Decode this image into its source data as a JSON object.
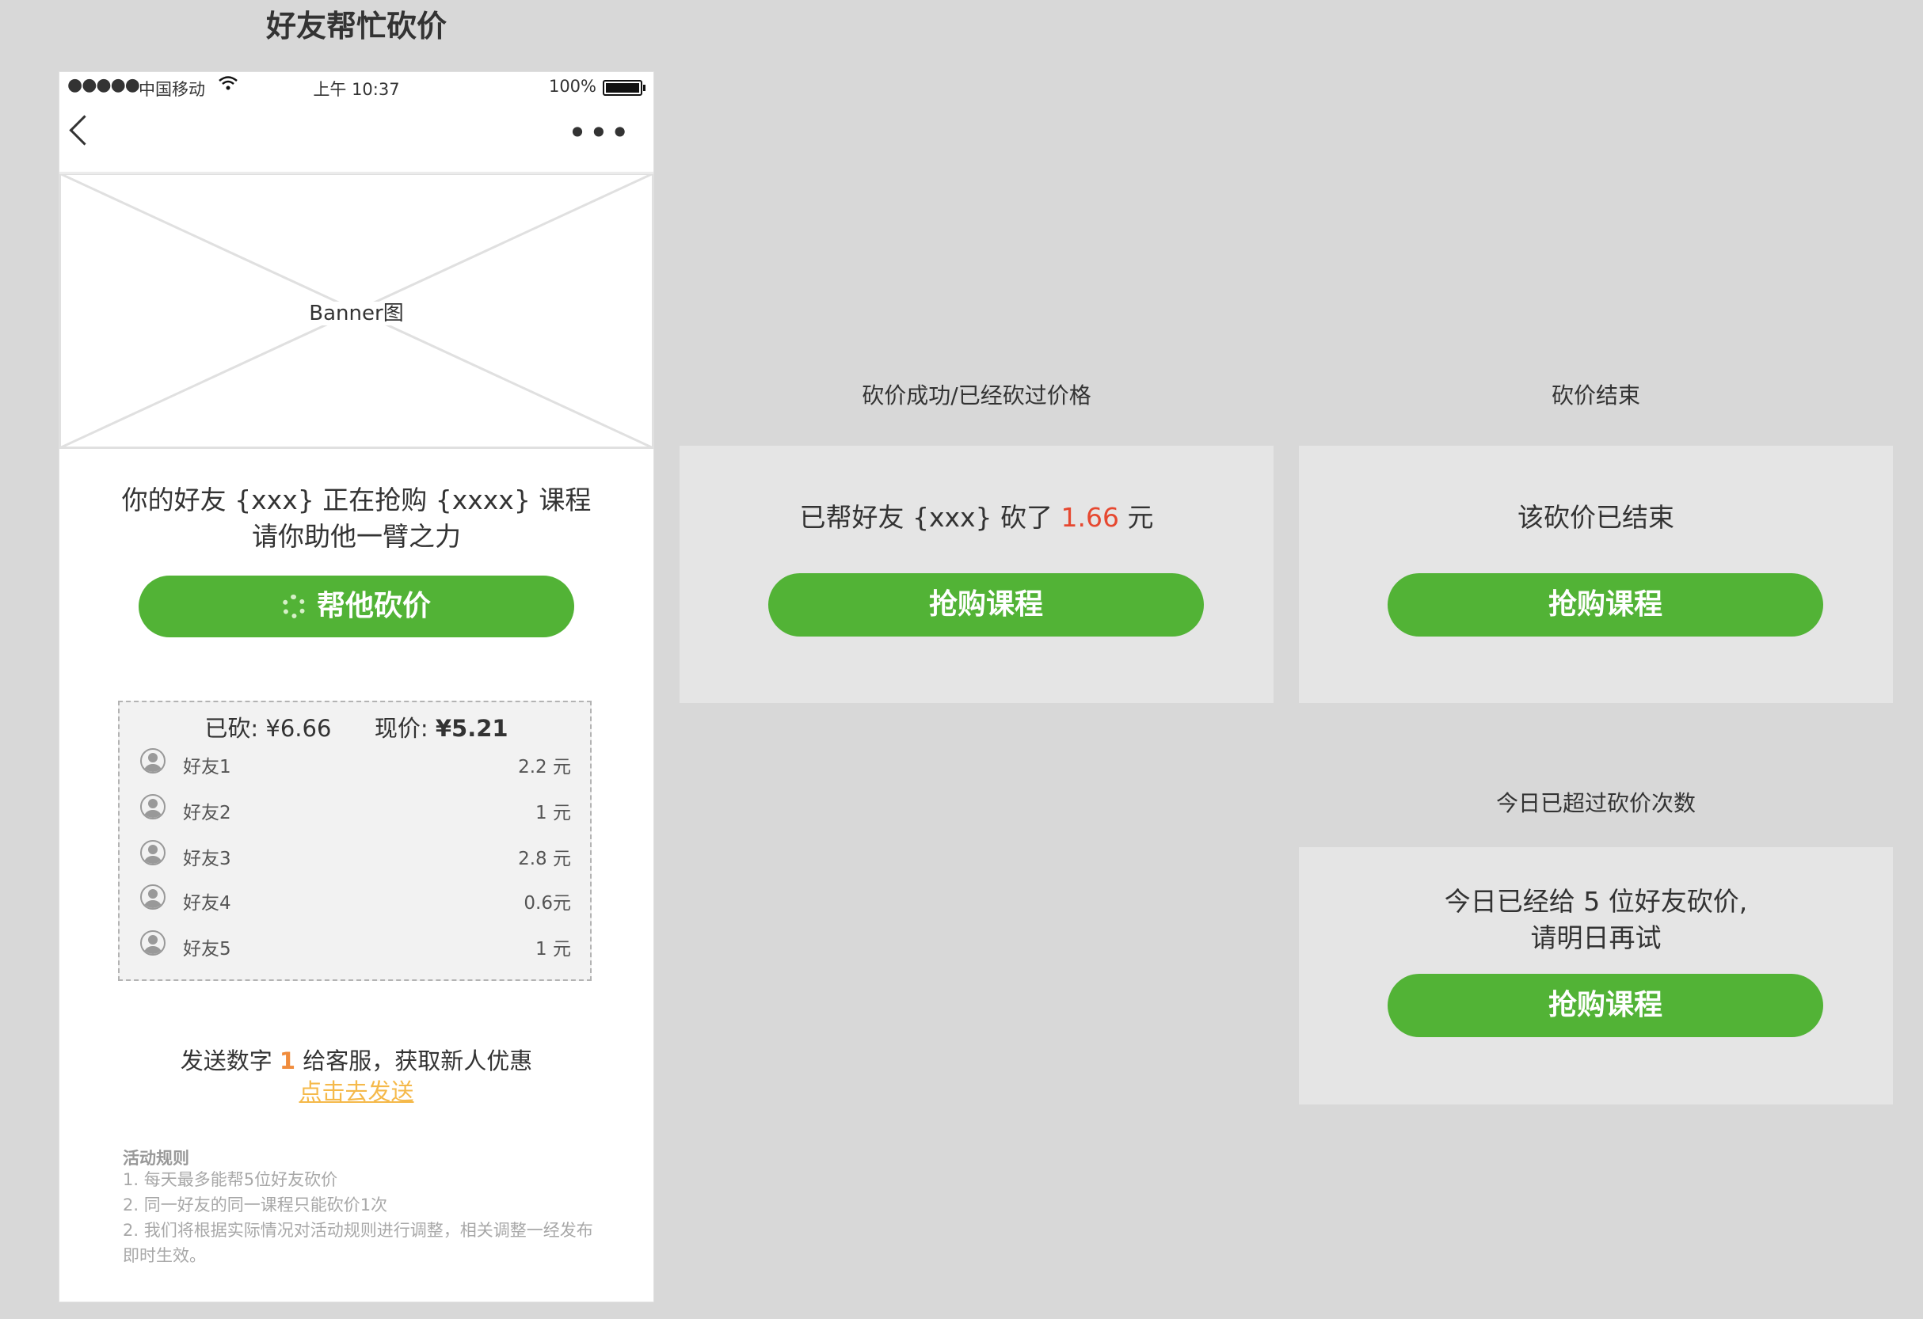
{
  "page_title": "好友帮忙砍价",
  "status_bar": {
    "signal": "●●●●●",
    "carrier": "中国移动",
    "time": "上午 10:37",
    "battery": "100%"
  },
  "navbar": {
    "back_icon": "chevron-left-icon",
    "more_icon": "more-dots-icon",
    "more_glyph": "•••"
  },
  "banner": {
    "label": "Banner图"
  },
  "invite": {
    "line1": "你的好友 {xxx} 正在抢购 {xxxx} 课程",
    "line2": "请你助他一臂之力"
  },
  "help_button": {
    "label": "帮他砍价"
  },
  "records": {
    "cut_label": "已砍:",
    "cut_value": "¥6.66",
    "price_label": "现价:",
    "price_value": "¥5.21",
    "items": [
      {
        "name": "好友1",
        "amount": "2.2 元"
      },
      {
        "name": "好友2",
        "amount": "1 元"
      },
      {
        "name": "好友3",
        "amount": "2.8 元"
      },
      {
        "name": "好友4",
        "amount": "0.6元"
      },
      {
        "name": "好友5",
        "amount": "1 元"
      }
    ]
  },
  "send": {
    "prefix": "发送数字 ",
    "number": "1",
    "suffix": " 给客服，获取新人优惠",
    "link": "点击去发送"
  },
  "rules": {
    "title": "活动规则",
    "items": [
      "1.  每天最多能帮5位好友砍价",
      "2. 同一好友的同一课程只能砍价1次",
      "2. 我们将根据实际情况对活动规则进行调整，相关调整一经发布即时生效。"
    ]
  },
  "success_panel": {
    "section_label": "砍价成功/已经砍过价格",
    "text_prefix": "已帮好友 {xxx} 砍了 ",
    "amount": "1.66",
    "text_suffix": " 元",
    "button": "抢购课程"
  },
  "ended_panel": {
    "section_label": "砍价结束",
    "text": "该砍价已结束",
    "button": "抢购课程"
  },
  "limit_panel": {
    "section_label": "今日已超过砍价次数",
    "line1": "今日已经给 5 位好友砍价,",
    "line2": "请明日再试",
    "button": "抢购课程"
  },
  "colors": {
    "accent_green": "#52b336",
    "highlight_red": "#e64830",
    "link_orange": "#f5b94a",
    "number_orange": "#f08c3c"
  }
}
